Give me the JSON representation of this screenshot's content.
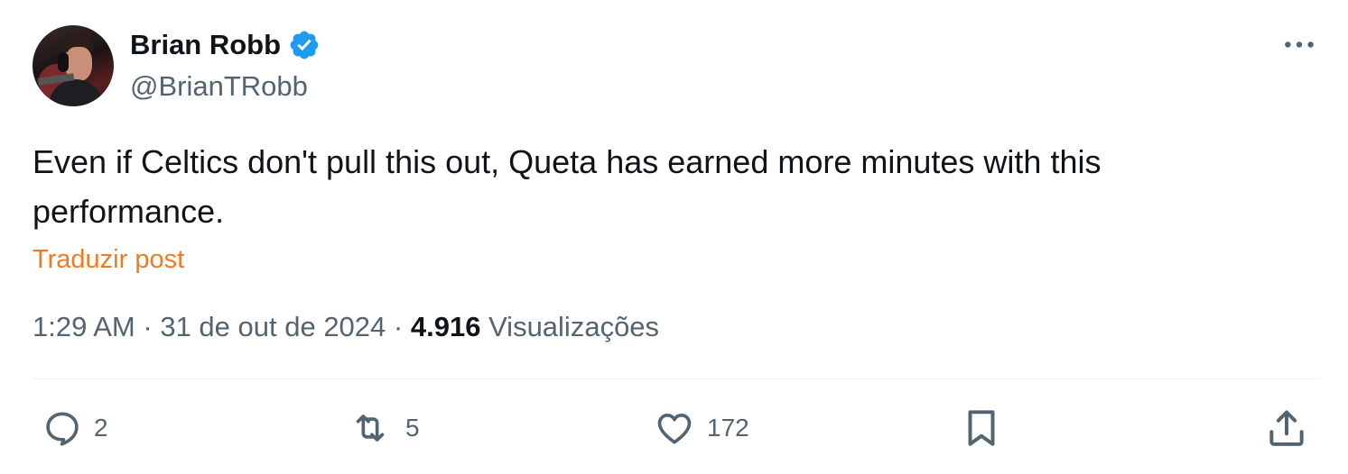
{
  "author": {
    "display_name": "Brian Robb",
    "handle": "@BrianTRobb",
    "verified": true,
    "verified_color": "#1d9bf0",
    "avatar_icon": "profile-photo"
  },
  "post": {
    "text": "Even if Celtics don't pull this out, Queta has earned more minutes with this performance.",
    "translate_label": "Traduzir post",
    "time": "1:29 AM",
    "separator": "·",
    "date": "31 de out de 2024",
    "views_count": "4.916",
    "views_label": "Visualizações"
  },
  "actions": {
    "reply": {
      "icon": "reply-icon",
      "count": "2"
    },
    "repost": {
      "icon": "repost-icon",
      "count": "5"
    },
    "like": {
      "icon": "heart-icon",
      "count": "172"
    },
    "bookmark": {
      "icon": "bookmark-icon"
    },
    "share": {
      "icon": "share-icon"
    }
  },
  "colors": {
    "text_primary": "#0f1419",
    "text_secondary": "#536471",
    "translate_link": "#f4791e",
    "divider": "#eff3f4"
  }
}
